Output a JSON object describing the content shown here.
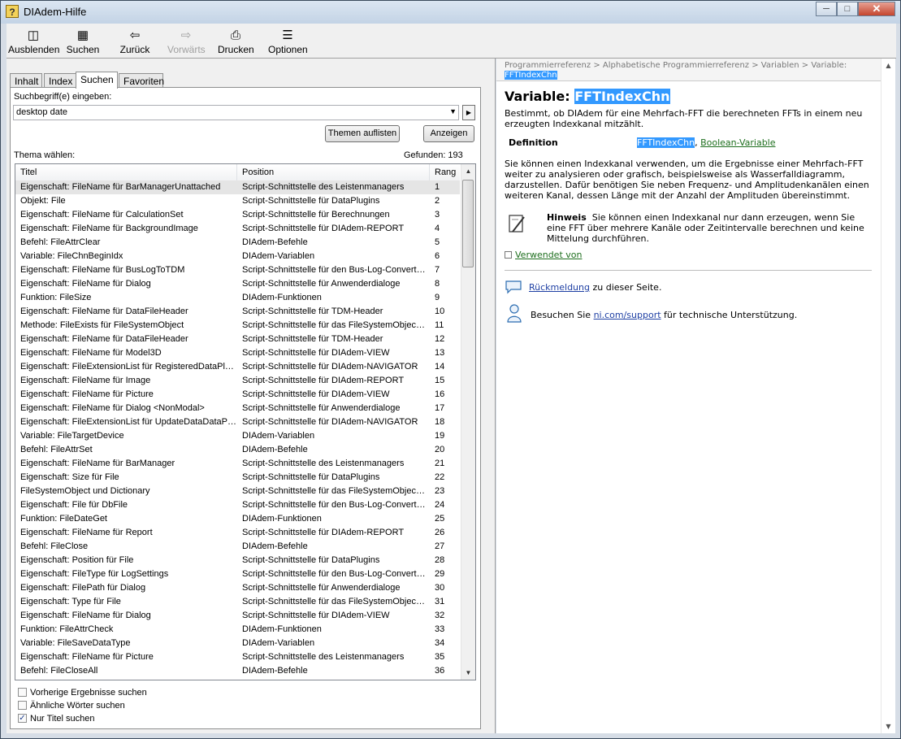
{
  "window": {
    "title": "DIAdem-Hilfe",
    "controls": [
      "minimize",
      "maximize",
      "close"
    ]
  },
  "toolbar": {
    "buttons": [
      {
        "label": "Ausblenden",
        "icon": "hide-pane-icon",
        "disabled": false
      },
      {
        "label": "Suchen",
        "icon": "search-pane-icon",
        "disabled": false
      },
      {
        "label": "Zurück",
        "icon": "back-arrow-icon",
        "disabled": false
      },
      {
        "label": "Vorwärts",
        "icon": "forward-arrow-icon",
        "disabled": true
      },
      {
        "label": "Drucken",
        "icon": "printer-icon",
        "disabled": false
      },
      {
        "label": "Optionen",
        "icon": "options-icon",
        "disabled": false
      }
    ]
  },
  "tabs": [
    "Inhalt",
    "Index",
    "Suchen",
    "Favoriten"
  ],
  "active_tab": "Suchen",
  "search": {
    "label": "Suchbegriff(e) eingeben:",
    "value": "desktop date",
    "list_topics_button": "Themen auflisten",
    "show_button": "Anzeigen",
    "choose_label": "Thema wählen:",
    "found_label": "Gefunden: 193"
  },
  "results": {
    "columns": [
      "Titel",
      "Position",
      "Rang"
    ],
    "rows": [
      [
        "Eigenschaft: FileName für BarManagerUnattached",
        "Script-Schnittstelle des Leistenmanagers",
        "1"
      ],
      [
        "Objekt: File",
        "Script-Schnittstelle für DataPlugins",
        "2"
      ],
      [
        "Eigenschaft: FileName für CalculationSet",
        "Script-Schnittstelle für Berechnungen",
        "3"
      ],
      [
        "Eigenschaft: FileName für BackgroundImage",
        "Script-Schnittstelle für DIAdem-REPORT",
        "4"
      ],
      [
        "Befehl: FileAttrClear",
        "DIAdem-Befehle",
        "5"
      ],
      [
        "Variable: FileChnBeginIdx",
        "DIAdem-Variablen",
        "6"
      ],
      [
        "Eigenschaft: FileName für BusLogToTDM",
        "Script-Schnittstelle für den Bus-Log-Converter...",
        "7"
      ],
      [
        "Eigenschaft: FileName für Dialog",
        "Script-Schnittstelle für Anwenderdialoge",
        "8"
      ],
      [
        "Funktion: FileSize",
        "DIAdem-Funktionen",
        "9"
      ],
      [
        "Eigenschaft: FileName für DataFileHeader",
        "Script-Schnittstelle für TDM-Header",
        "10"
      ],
      [
        "Methode: FileExists für FileSystemObject",
        "Script-Schnittstelle für das FileSystemObject-...",
        "11"
      ],
      [
        "Eigenschaft: FileName für DataFileHeader",
        "Script-Schnittstelle für TDM-Header",
        "12"
      ],
      [
        "Eigenschaft: FileName für Model3D",
        "Script-Schnittstelle für DIAdem-VIEW",
        "13"
      ],
      [
        "Eigenschaft: FileExtensionList für RegisteredDataPlugi...",
        "Script-Schnittstelle für DIAdem-NAVIGATOR",
        "14"
      ],
      [
        "Eigenschaft: FileName für Image",
        "Script-Schnittstelle für DIAdem-REPORT",
        "15"
      ],
      [
        "Eigenschaft: FileName für Picture",
        "Script-Schnittstelle für DIAdem-VIEW",
        "16"
      ],
      [
        "Eigenschaft: FileName für Dialog <NonModal>",
        "Script-Schnittstelle für Anwenderdialoge",
        "17"
      ],
      [
        "Eigenschaft: FileExtensionList für UpdateDataDataPlu...",
        "Script-Schnittstelle für DIAdem-NAVIGATOR",
        "18"
      ],
      [
        "Variable: FileTargetDevice",
        "DIAdem-Variablen",
        "19"
      ],
      [
        "Befehl: FileAttrSet",
        "DIAdem-Befehle",
        "20"
      ],
      [
        "Eigenschaft: FileName für BarManager",
        "Script-Schnittstelle des Leistenmanagers",
        "21"
      ],
      [
        "Eigenschaft: Size für File",
        "Script-Schnittstelle für DataPlugins",
        "22"
      ],
      [
        "FileSystemObject und Dictionary",
        "Script-Schnittstelle für das FileSystemObject-...",
        "23"
      ],
      [
        "Eigenschaft: File für DbFile",
        "Script-Schnittstelle für den Bus-Log-Converter...",
        "24"
      ],
      [
        "Funktion: FileDateGet",
        "DIAdem-Funktionen",
        "25"
      ],
      [
        "Eigenschaft: FileName für Report",
        "Script-Schnittstelle für DIAdem-REPORT",
        "26"
      ],
      [
        "Befehl: FileClose",
        "DIAdem-Befehle",
        "27"
      ],
      [
        "Eigenschaft: Position für File",
        "Script-Schnittstelle für DataPlugins",
        "28"
      ],
      [
        "Eigenschaft: FileType für LogSettings",
        "Script-Schnittstelle für den Bus-Log-Converter...",
        "29"
      ],
      [
        "Eigenschaft: FilePath für Dialog",
        "Script-Schnittstelle für Anwenderdialoge",
        "30"
      ],
      [
        "Eigenschaft: Type für File",
        "Script-Schnittstelle für das FileSystemObject-...",
        "31"
      ],
      [
        "Eigenschaft: FileName für Dialog",
        "Script-Schnittstelle für DIAdem-VIEW",
        "32"
      ],
      [
        "Funktion: FileAttrCheck",
        "DIAdem-Funktionen",
        "33"
      ],
      [
        "Variable: FileSaveDataType",
        "DIAdem-Variablen",
        "34"
      ],
      [
        "Eigenschaft: FileName für Picture",
        "Script-Schnittstelle des Leistenmanagers",
        "35"
      ],
      [
        "Befehl: FileCloseAll",
        "DIAdem-Befehle",
        "36"
      ]
    ]
  },
  "options": [
    {
      "label": "Vorherige Ergebnisse suchen",
      "checked": false
    },
    {
      "label": "Ähnliche Wörter suchen",
      "checked": false
    },
    {
      "label": "Nur Titel suchen",
      "checked": true
    }
  ],
  "topic": {
    "breadcrumb": "Programmierreferenz > Alphabetische Programmierreferenz > Variablen > Variable:",
    "breadcrumb_highlight": "FFTIndexChn",
    "title_prefix": "Variable: ",
    "title_name": "FFTIndexChn",
    "summary": "Bestimmt, ob DIAdem für eine Mehrfach-FFT die berechneten FFTs in einem neu erzeugten Indexkanal mitzählt.",
    "definition_label": "Definition",
    "definition_name": "FFTIndexChn",
    "definition_sep": ", ",
    "definition_type": "Boolean-Variable",
    "body": "Sie können einen Indexkanal verwenden, um die Ergebnisse einer Mehrfach-FFT weiter zu analysieren oder grafisch, beispielsweise als Wasserfalldiagramm, darzustellen. Dafür benötigen Sie neben Frequenz- und Amplitudenkanälen einen weiteren Kanal, dessen Länge mit der Anzahl der Amplituden übereinstimmt.",
    "hint_label": "Hinweis",
    "hint_text": "Sie können einen Indexkanal nur dann erzeugen, wenn Sie eine FFT über mehrere Kanäle oder Zeitintervalle berechnen und keine Mittelung durchführen.",
    "used_by": "Verwendet von",
    "feedback_link": "Rückmeldung",
    "feedback_text": " zu dieser Seite.",
    "support_prefix": "Besuchen Sie ",
    "support_link": "ni.com/support",
    "support_suffix": " für technische Unterstützung."
  }
}
